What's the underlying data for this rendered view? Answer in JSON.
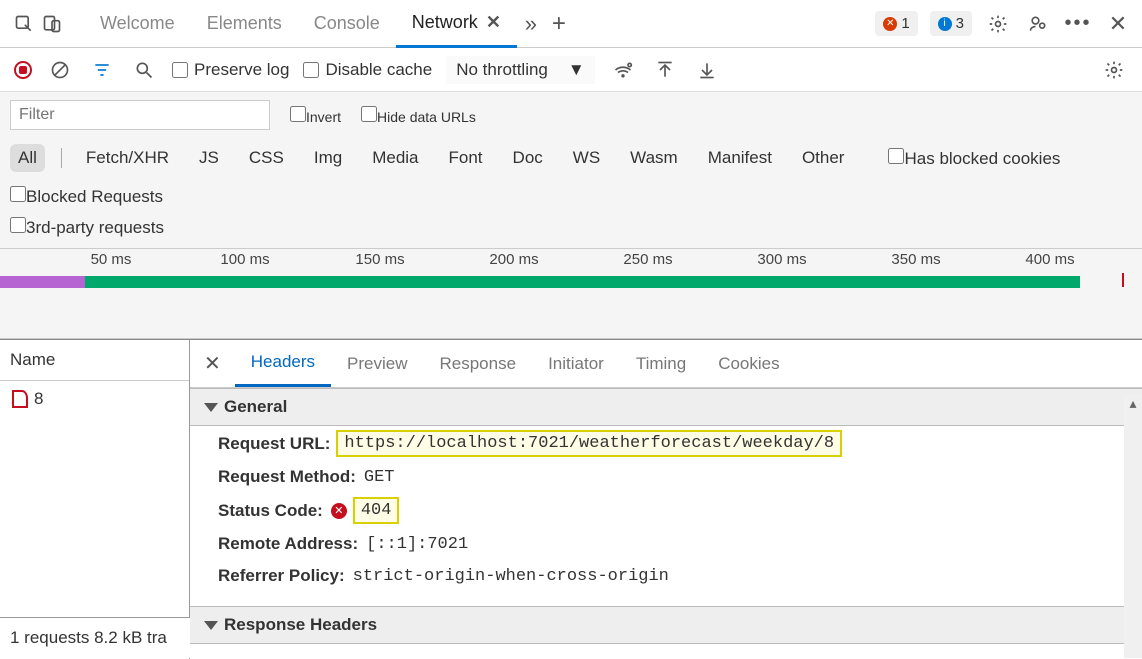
{
  "tabs": {
    "welcome": "Welcome",
    "elements": "Elements",
    "console": "Console",
    "network": "Network"
  },
  "counts": {
    "errors": "1",
    "info": "3"
  },
  "toolbar": {
    "preserve": "Preserve log",
    "disable_cache": "Disable cache",
    "throttle": "No throttling"
  },
  "filter": {
    "placeholder": "Filter",
    "invert": "Invert",
    "hide_urls": "Hide data URLs",
    "blocked_cookies": "Has blocked cookies",
    "blocked_req": "Blocked Requests",
    "third_party": "3rd-party requests"
  },
  "types": [
    "All",
    "Fetch/XHR",
    "JS",
    "CSS",
    "Img",
    "Media",
    "Font",
    "Doc",
    "WS",
    "Wasm",
    "Manifest",
    "Other"
  ],
  "timeline": {
    "ticks": [
      "50 ms",
      "100 ms",
      "150 ms",
      "200 ms",
      "250 ms",
      "300 ms",
      "350 ms",
      "400 ms"
    ]
  },
  "namecol": {
    "header": "Name",
    "row0": "8"
  },
  "dtabs": [
    "Headers",
    "Preview",
    "Response",
    "Initiator",
    "Timing",
    "Cookies"
  ],
  "sections": {
    "general": "General",
    "response_headers": "Response Headers"
  },
  "kv": {
    "url_k": "Request URL:",
    "url_v": "https://localhost:7021/weatherforecast/weekday/8",
    "method_k": "Request Method:",
    "method_v": "GET",
    "status_k": "Status Code:",
    "status_v": "404",
    "remote_k": "Remote Address:",
    "remote_v": "[::1]:7021",
    "ref_k": "Referrer Policy:",
    "ref_v": "strict-origin-when-cross-origin"
  },
  "status": {
    "text": "1 requests   8.2 kB tra"
  }
}
